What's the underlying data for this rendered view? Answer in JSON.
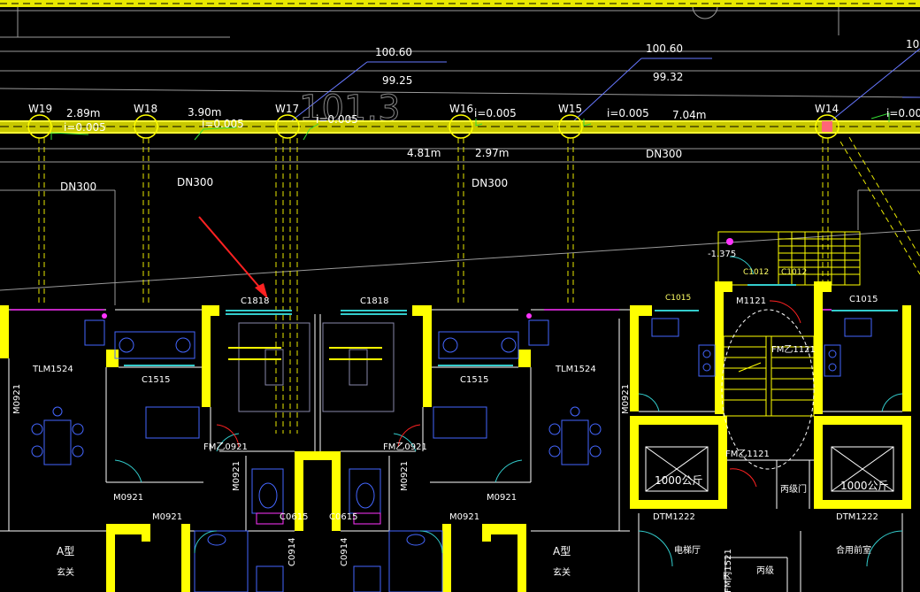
{
  "drawing": {
    "grade_labels": {
      "top_left": "100.60",
      "bottom_left": "99.25",
      "top_right": "100.60",
      "bottom_right": "99.32"
    },
    "background_text": "101.3",
    "manholes": [
      "W19",
      "W18",
      "W17",
      "W16",
      "W15",
      "W14"
    ],
    "lengths": [
      "2.89m",
      "3.90m",
      "7.04m",
      "4.81m",
      "2.97m"
    ],
    "slopes": [
      "i=0.005",
      "i=0.005",
      "i=0.005",
      "i=0.005",
      "i=0.005",
      "i=0.00"
    ],
    "pipe_sizes": [
      "DN300",
      "DN300",
      "DN300",
      "DN300"
    ],
    "edge_label": "10",
    "elevation": "-1.375",
    "windows": [
      "C1818",
      "C1818",
      "C1015",
      "C1015",
      "C1012",
      "C1012",
      "C1515",
      "C1515"
    ],
    "doors": [
      "TLM1524",
      "TLM1524",
      "M0921",
      "M0921",
      "M0921",
      "M0921",
      "M0921",
      "M0921",
      "M0921",
      "M0921",
      "FM乙0921",
      "FM乙0921",
      "FM乙1121",
      "FM乙1121",
      "FM丙1521",
      "DTM1222",
      "DTM1222",
      "M1121",
      "C0615",
      "C0615",
      "C0914",
      "C0914"
    ],
    "elevator_capacity": [
      "1000公斤",
      "1000公斤"
    ],
    "misc": [
      "A型",
      "A型",
      "玄关",
      "玄关",
      "丙级门",
      "电梯厅",
      "合用前室",
      "丙级"
    ]
  },
  "colors": {
    "background": "#000000",
    "walls": "#ffff00",
    "pipe": "#e8e800",
    "text": "#ffffff",
    "grid": "#9a9a9a",
    "blue": "#4466ff",
    "cyan": "#33cccc",
    "magenta": "#ff33ff",
    "red": "#ff2222"
  }
}
